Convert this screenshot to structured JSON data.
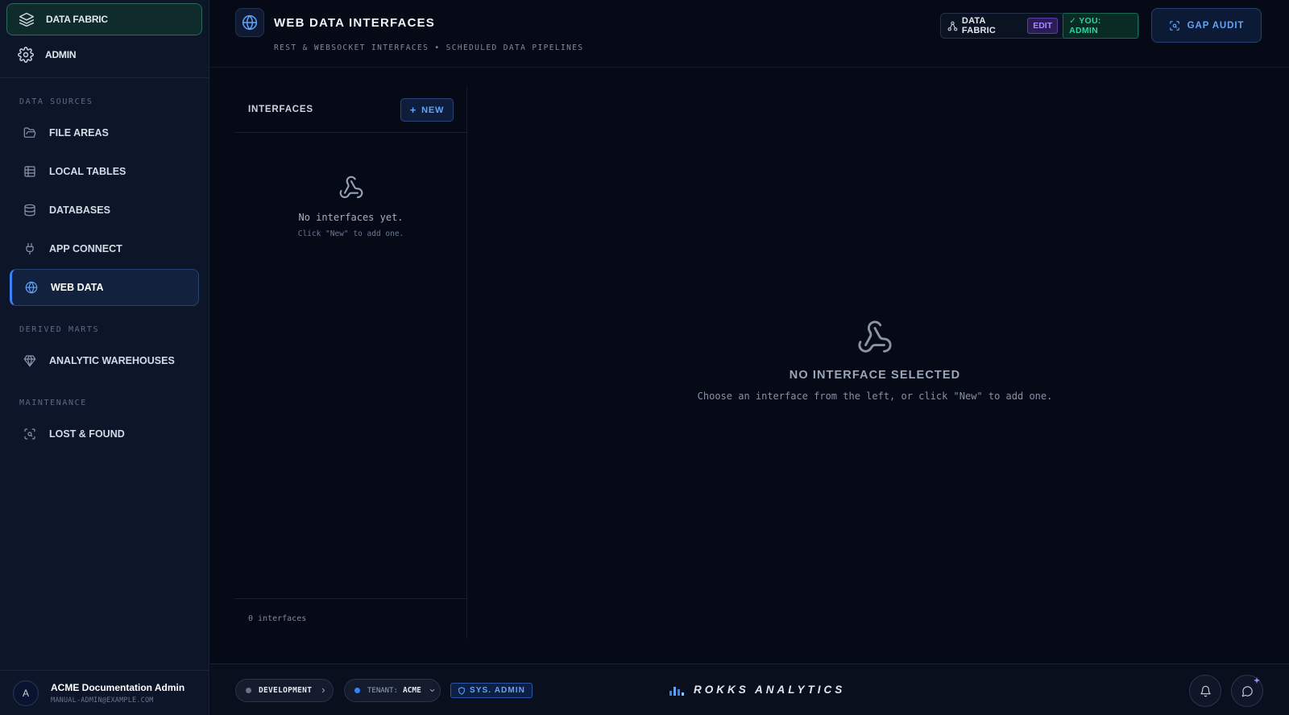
{
  "sidebar": {
    "top_items": [
      {
        "label": "DATA FABRIC",
        "icon": "layers-icon",
        "active": true
      },
      {
        "label": "ADMIN",
        "icon": "gear-icon",
        "active": false
      }
    ],
    "sections": [
      {
        "label": "DATA SOURCES",
        "items": [
          {
            "label": "FILE AREAS",
            "icon": "folder-open-icon"
          },
          {
            "label": "LOCAL TABLES",
            "icon": "table-icon"
          },
          {
            "label": "DATABASES",
            "icon": "database-icon"
          },
          {
            "label": "APP CONNECT",
            "icon": "plug-icon"
          },
          {
            "label": "WEB DATA",
            "icon": "globe-icon",
            "active": true
          }
        ]
      },
      {
        "label": "DERIVED MARTS",
        "items": [
          {
            "label": "ANALYTIC WAREHOUSES",
            "icon": "gem-icon"
          }
        ]
      },
      {
        "label": "MAINTENANCE",
        "items": [
          {
            "label": "LOST & FOUND",
            "icon": "scan-search-icon"
          }
        ]
      }
    ],
    "user": {
      "initial": "A",
      "name": "ACME Documentation Admin",
      "email": "MANUAL-ADMIN@EXAMPLE.COM"
    }
  },
  "header": {
    "title": "WEB DATA INTERFACES",
    "subtitle": "REST & WEBSOCKET INTERFACES • SCHEDULED DATA PIPELINES",
    "fabric_label": "DATA FABRIC",
    "edit_badge": "EDIT",
    "role_badge": "✓ YOU: ADMIN",
    "gap_audit_label": "GAP AUDIT"
  },
  "interfaces_panel": {
    "title": "INTERFACES",
    "new_label": "NEW",
    "empty_title": "No interfaces yet.",
    "empty_hint": "Click \"New\" to add one.",
    "count_label": "0 interfaces"
  },
  "detail": {
    "empty_title": "NO INTERFACE SELECTED",
    "empty_hint": "Choose an interface from the left, or click \"New\" to add one."
  },
  "footer": {
    "environment": "DEVELOPMENT",
    "environment_dot_color": "#6b7280",
    "tenant_label": "TENANT:",
    "tenant_value": "ACME",
    "tenant_dot_color": "#3b82f6",
    "sys_badge": "SYS. ADMIN",
    "brand": "ROKKS ANALYTICS"
  },
  "colors": {
    "accent": "#3b82f6",
    "background": "#060a17",
    "sidebar": "#0d1528",
    "success": "#34d399",
    "edit": "#a78bfa"
  }
}
